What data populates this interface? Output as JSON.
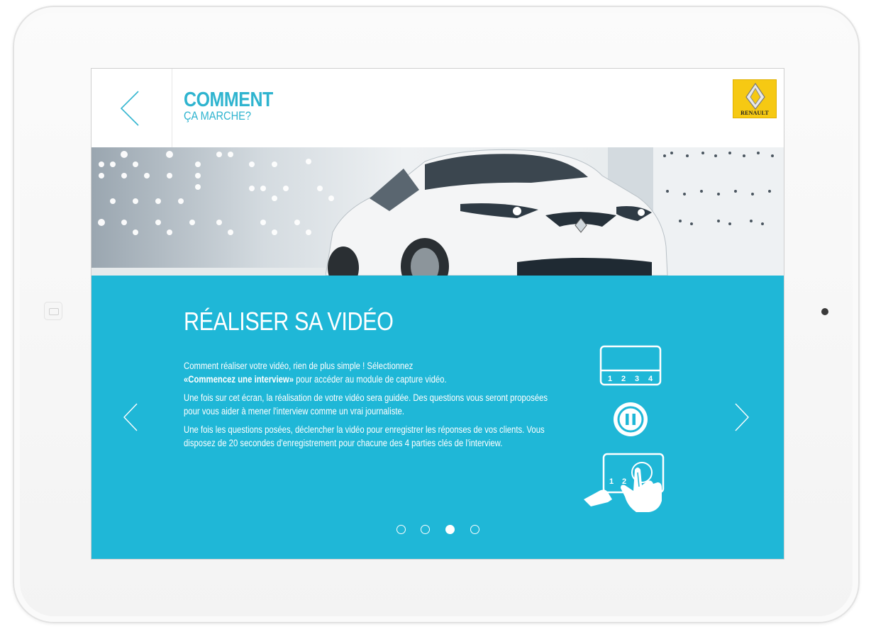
{
  "header": {
    "title": "COMMENT",
    "subtitle": "ÇA MARCHE?",
    "logo_text": "RENAULT"
  },
  "section": {
    "title": "RÉALISER SA VIDÉO",
    "paragraph1_part1": "Comment réaliser votre vidéo, rien de plus simple ! Sélectionnez",
    "paragraph1_bold": "«Commencez une interview»",
    "paragraph1_part2": " pour accéder au module de capture vidéo.",
    "paragraph2": "Une fois sur cet écran, la réalisation de votre vidéo sera guidée. Des questions vous seront proposées pour vous aider à mener l'interview comme un vrai journaliste.",
    "paragraph3": "Une fois les questions posées, déclencher la vidéo pour enregistrer les réponses de vos clients. Vous disposez de 20 secondes d'enregistrement pour chacune des 4 parties clés de l'interview."
  },
  "icons": {
    "timeline_numbers": [
      "1",
      "2",
      "3",
      "4"
    ],
    "touch_numbers": [
      "1",
      "2"
    ]
  },
  "pagination": {
    "total": 4,
    "active_index": 2
  },
  "colors": {
    "accent": "#1fb7d7",
    "title_blue": "#2fb4cf",
    "logo_yellow": "#f6c913"
  }
}
